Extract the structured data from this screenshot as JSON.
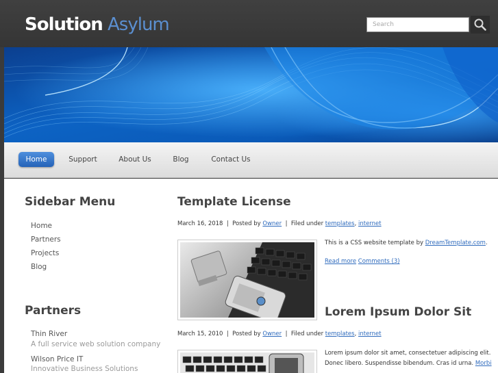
{
  "header": {
    "logo_word1": "Solution",
    "logo_word2": "Asylum",
    "search_placeholder": "Search",
    "search_icon": "magnifier-icon"
  },
  "nav": {
    "items": [
      {
        "label": "Home",
        "active": true
      },
      {
        "label": "Support",
        "active": false
      },
      {
        "label": "About Us",
        "active": false
      },
      {
        "label": "Blog",
        "active": false
      },
      {
        "label": "Contact Us",
        "active": false
      }
    ]
  },
  "sidebar": {
    "menu_title": "Sidebar Menu",
    "menu_items": [
      "Home",
      "Partners",
      "Projects",
      "Blog"
    ],
    "partners_title": "Partners",
    "partners": [
      {
        "name": "Thin River",
        "desc": "A full service web solution company"
      },
      {
        "name": "Wilson Price IT",
        "desc": "Innovative Business Solutions"
      }
    ]
  },
  "posts": [
    {
      "title": "Template License",
      "date": "March 16, 2018",
      "posted_by": "Posted by",
      "author": "Owner",
      "filed_under": "Filed under",
      "tags": [
        "templates",
        "internet"
      ],
      "text": "This is a CSS website template by",
      "text_link": "DreamTemplate.com",
      "text_end": ".",
      "read_more": "Read more",
      "comments": "Comments (3)"
    },
    {
      "title": "Lorem Ipsum Dolor Sit",
      "date": "March 15, 2010",
      "posted_by": "Posted by",
      "author": "Owner",
      "filed_under": "Filed under",
      "tags": [
        "templates",
        "internet"
      ],
      "line1": "Lorem ipsum dolor sit amet, consectetuer adipiscing elit.",
      "line2": "Donec libero. Suspendisse bibendum. Cras id urna.",
      "line2_link": "Morbi"
    }
  ],
  "colors": {
    "header_bg": "#3b3b3b",
    "accent": "#2f6bbd",
    "logo_accent": "#5b8fd0",
    "banner_blue": "#0a4fa8"
  }
}
